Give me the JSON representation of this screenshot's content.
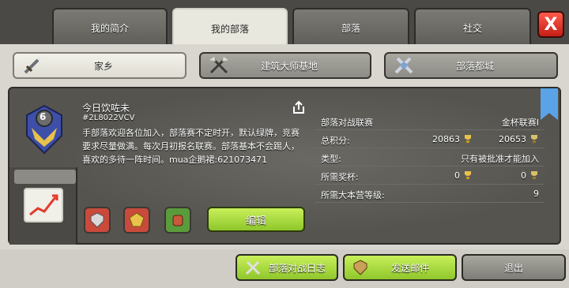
{
  "tabs": [
    {
      "label": "我的简介",
      "active": false
    },
    {
      "label": "我的部落",
      "active": true
    },
    {
      "label": "部落",
      "active": false
    },
    {
      "label": "社交",
      "active": false
    }
  ],
  "close_label": "X",
  "subnav": [
    {
      "label": "家乡",
      "icon": "sword-icon",
      "active": true
    },
    {
      "label": "建筑大师基地",
      "icon": "crossed-axes-icon",
      "active": false
    },
    {
      "label": "部落都城",
      "icon": "crossed-swords-icon",
      "active": false
    }
  ],
  "clan": {
    "level": "6",
    "name": "今日饮咗未",
    "tag": "#2L8022VCV",
    "description": "手部落欢迎各位加入，部落赛不定时开，默认绿牌，竞赛要求尽量做满。每次月初报名联赛。部落基本不会踢人，喜欢的多待一阵时间。mua企鹅裙:621073471",
    "edit_label": "编辑"
  },
  "stats": {
    "war_league_label": "部落对战联赛",
    "war_league_value": "金杯联赛I",
    "total_points_label": "总积分:",
    "points_home": "20863",
    "points_builder": "20653",
    "type_label": "类型:",
    "type_value": "只有被批准才能加入",
    "required_trophies_label": "所需奖杯:",
    "required_trophies_home": "0",
    "required_trophies_builder": "0",
    "required_townhall_label": "所需大本营等级:",
    "required_townhall_value": "9"
  },
  "bottom": {
    "war_log_label": "部落对战日志",
    "send_mail_label": "发送邮件",
    "leave_label": "退出"
  },
  "colors": {
    "green_button": "#8fc72b",
    "close_red": "#c41e16",
    "ribbon_blue": "#5aa3e6"
  }
}
